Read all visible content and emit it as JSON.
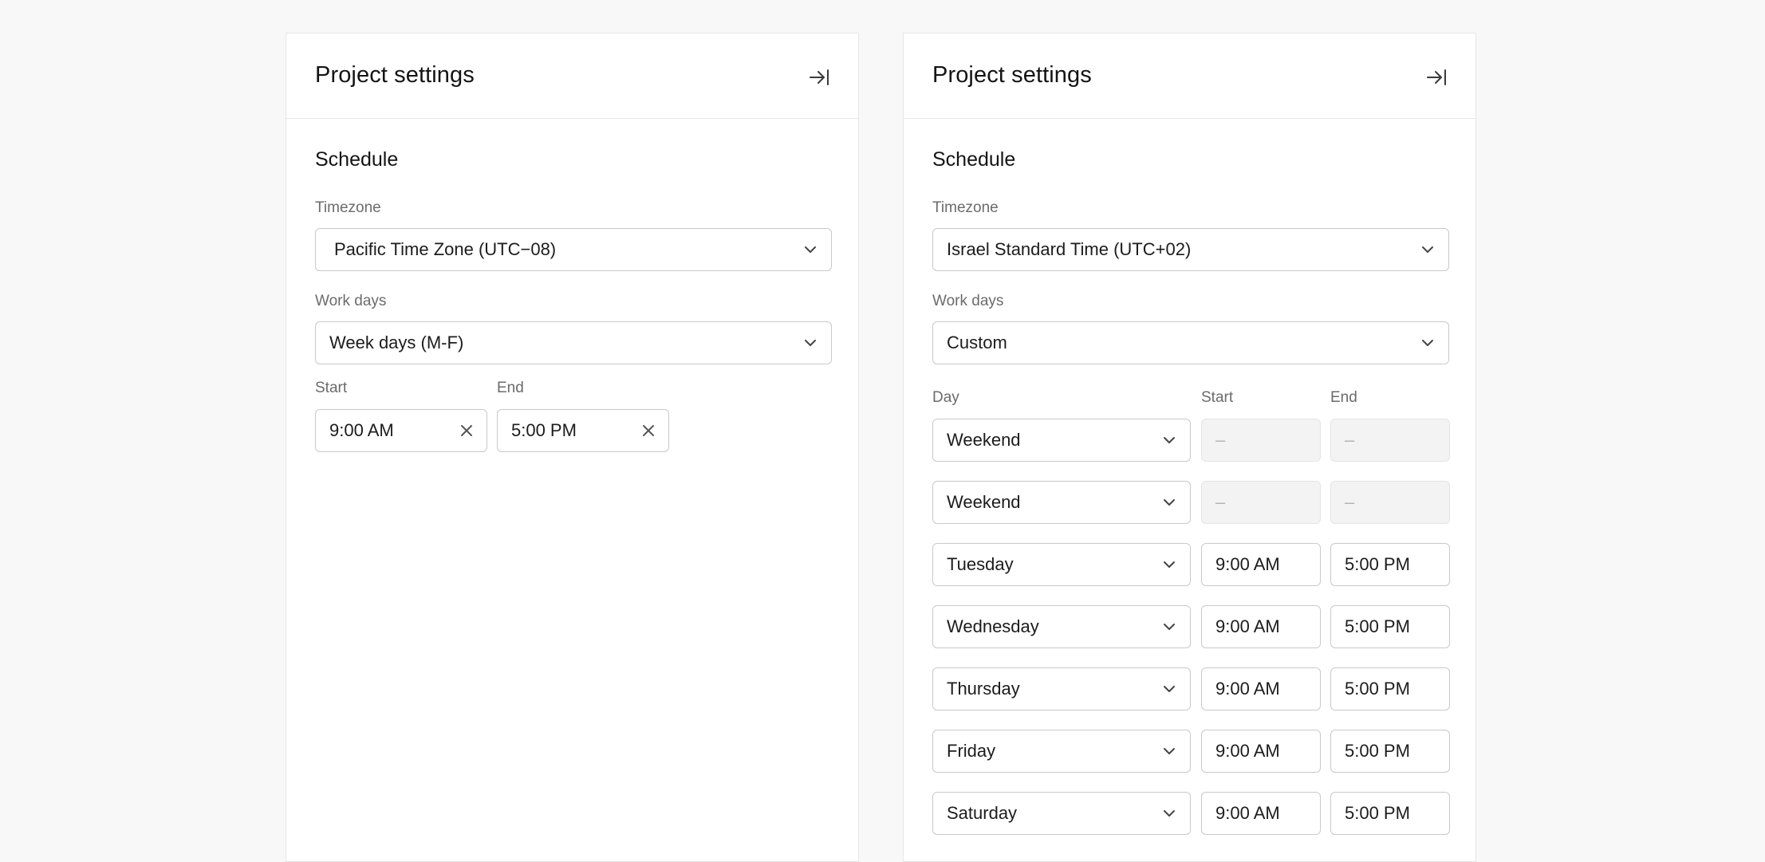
{
  "left_panel": {
    "title": "Project settings",
    "section": "Schedule",
    "timezone_label": "Timezone",
    "timezone_value": "Pacific Time Zone (UTC−08)",
    "workdays_label": "Work days",
    "workdays_value": "Week days (M-F)",
    "start_label": "Start",
    "start_value": "9:00 AM",
    "end_label": "End",
    "end_value": "5:00 PM"
  },
  "right_panel": {
    "title": "Project settings",
    "section": "Schedule",
    "timezone_label": "Timezone",
    "timezone_value": "Israel Standard Time (UTC+02)",
    "workdays_label": "Work days",
    "workdays_value": "Custom",
    "day_col_label": "Day",
    "start_col_label": "Start",
    "end_col_label": "End",
    "rows": [
      {
        "day": "Weekend",
        "start": "–",
        "end": "–"
      },
      {
        "day": "Weekend",
        "start": "–",
        "end": "–"
      },
      {
        "day": "Tuesday",
        "start": "9:00 AM",
        "end": "5:00 PM"
      },
      {
        "day": "Wednesday",
        "start": "9:00 AM",
        "end": "5:00 PM"
      },
      {
        "day": "Thursday",
        "start": "9:00 AM",
        "end": "5:00 PM"
      },
      {
        "day": "Friday",
        "start": "9:00 AM",
        "end": "5:00 PM"
      },
      {
        "day": "Saturday",
        "start": "9:00 AM",
        "end": "5:00 PM"
      }
    ]
  },
  "icons": {
    "collapse": "arrow-right-to-line-icon",
    "chevron": "chevron-down-icon",
    "clear": "close-icon"
  },
  "colors": {
    "background": "#f8f8f8",
    "panel": "#ffffff",
    "border": "#c9c9c9",
    "label": "#6b6b6b",
    "disabled_bg": "#f3f3f3"
  }
}
